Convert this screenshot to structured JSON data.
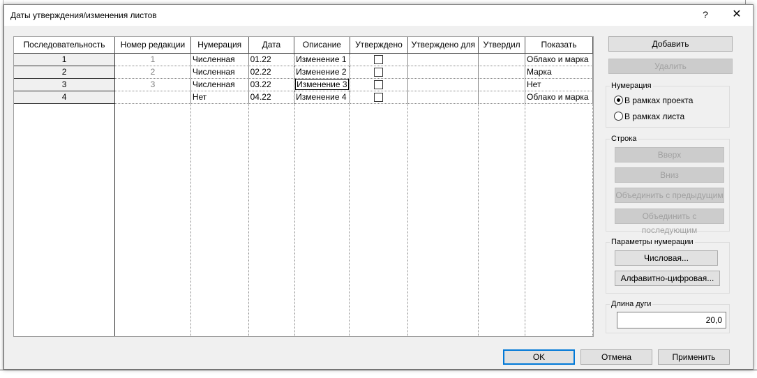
{
  "dialog": {
    "title": "Даты утверждения/изменения листов",
    "help_label": "?",
    "close_label": "✕"
  },
  "grid": {
    "columns": [
      "Последовательность",
      "Номер редакции",
      "Нумерация",
      "Дата",
      "Описание",
      "Утверждено",
      "Утверждено для",
      "Утвердил",
      "Показать"
    ],
    "rows": [
      {
        "seq": "1",
        "rev": "1",
        "numbering": "Численная",
        "date": "01.22",
        "desc": "Изменение 1",
        "approved": false,
        "approved_for": "",
        "approved_by": "",
        "show": "Облако и марка"
      },
      {
        "seq": "2",
        "rev": "2",
        "numbering": "Численная",
        "date": "02.22",
        "desc": "Изменение 2",
        "approved": false,
        "approved_for": "",
        "approved_by": "",
        "show": "Марка"
      },
      {
        "seq": "3",
        "rev": "3",
        "numbering": "Численная",
        "date": "03.22",
        "desc": "Изменение 3",
        "approved": false,
        "approved_for": "",
        "approved_by": "",
        "show": "Нет"
      },
      {
        "seq": "4",
        "rev": "",
        "numbering": "Нет",
        "date": "04.22",
        "desc": "Изменение 4",
        "approved": false,
        "approved_for": "",
        "approved_by": "",
        "show": "Облако и марка"
      }
    ]
  },
  "panel": {
    "add_label": "Добавить",
    "delete_label": "Удалить",
    "numbering_group": "Нумерация",
    "radio_project": "В рамках проекта",
    "radio_sheet": "В рамках листа",
    "row_group": "Строка",
    "up_label": "Вверх",
    "down_label": "Вниз",
    "merge_prev_label": "Объединить с предыдущим",
    "merge_next_label": "Объединить с последующим",
    "numbering_params_group": "Параметры нумерации",
    "numeric_label": "Числовая...",
    "alnum_label": "Алфавитно-цифровая...",
    "arc_group": "Длина дуги",
    "arc_value": "20,0"
  },
  "footer": {
    "ok_label": "OK",
    "cancel_label": "Отмена",
    "apply_label": "Применить"
  },
  "colors": {
    "dialog_bg": "#f0f0f0",
    "disabled_text": "#a0a0a0",
    "focus_border": "#0078d7"
  }
}
